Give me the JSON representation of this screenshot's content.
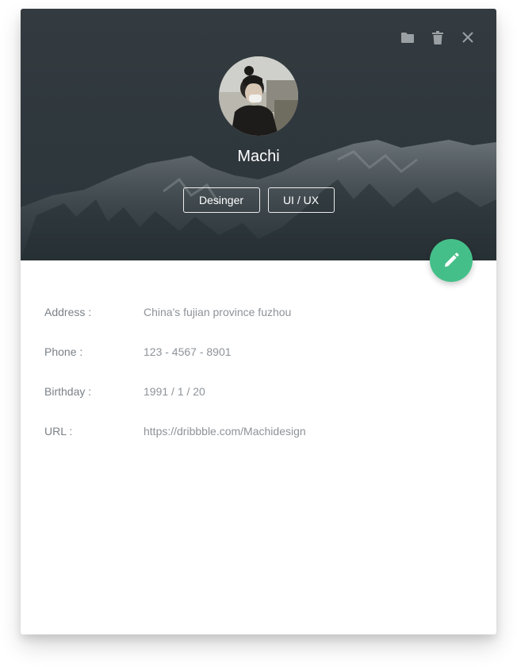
{
  "profile": {
    "name": "Machi",
    "tags": [
      "Desinger",
      "UI / UX"
    ]
  },
  "toolbar": {
    "icons": [
      "folder-icon",
      "trash-icon",
      "close-icon"
    ]
  },
  "fab": {
    "icon": "pencil-icon",
    "color": "#45bf89"
  },
  "details": [
    {
      "label": "Address :",
      "value": "China's fujian province fuzhou"
    },
    {
      "label": "Phone :",
      "value": "123 - 4567 - 8901"
    },
    {
      "label": "Birthday :",
      "value": "1991 / 1 / 20"
    },
    {
      "label": "URL :",
      "value": "https://dribbble.com/Machidesign"
    }
  ],
  "colors": {
    "header_bg": "#2f383d",
    "accent": "#45bf89",
    "text_muted": "#7f868b"
  }
}
